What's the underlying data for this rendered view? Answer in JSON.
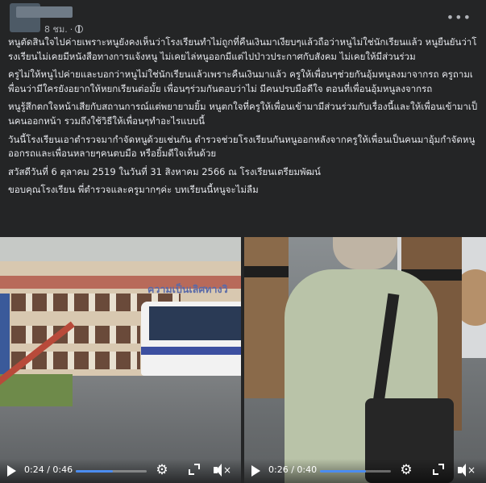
{
  "post": {
    "time": "8 ชม.",
    "separator": "·",
    "privacy_icon": "globe-icon",
    "more_icon": "more-horizontal-icon",
    "paragraphs": [
      "หนูตัดสินใจไปค่ายเพราะหนูยังคงเห็นว่าโรงเรียนทำไม่ถูกที่คืนเงินมาเงียบๆแล้วถือว่าหนูไม่ใช่นักเรียนแล้ว หนูยืนยันว่าโรงเรียนไม่เคยมีหนังสือทางการแจ้งหนู ไม่เคยไล่หนูออกมีแต่ไปป่าวประกาศกับสังคม ไม่เคยให้มีส่วนร่วม",
      "ครูไม่ให้หนูไปค่ายและบอกว่าหนูไม่ใช่นักเรียนแล้วเพราะคืนเงินมาแล้ว ครูให้เพื่อนๆช่วยกันอุ้มหนูลงมาจากรถ ครูถามเพื่อนว่ามีใครยังอยากให้หยกเรียนต่อมั้ย เพื่อนๆร่วมกันตอบว่าไม่ มีคนปรบมือดีใจ ตอนที่เพื่อนอุ้มหนูลงจากรถ",
      "หนูรู้สึกตกใจหน้าเสียกับสถานการณ์แต่พยายามยิ้ม หนูตกใจที่ครูให้เพื่อนเข้ามามีส่วนร่วมกับเรื่องนี้และให้เพื่อนเข้ามาเป็นคนออกหน้า รวมถึงใช้วิธีให้เพื่อนๆทำอะไรแบบนี้",
      "วันนี้โรงเรียนเอาตำรวจมากำจัดหนูด้วยเช่นกัน ตำรวจช่วยโรงเรียนกันหนูออกหลังจากครูให้เพื่อนเป็นคนมาอุ้มกำจัดหนูออกรถและเพื่อนหลายๆคนตบมือ หรือยิ้มดีใจเห็นด้วย",
      "สวัสดีวันที่ 6 ตุลาคม 2519 ในวันที่ 31 สิงหาคม 2566 ณ โรงเรียนเตรียมพัฒน์",
      "ขอบคุณโรงเรียน พี่ตำรวจและครูมากๆค่ะ บทเรียนนี้หนูจะไม่ลืม"
    ]
  },
  "videos": [
    {
      "signage": "ความเป็นเลิศทางวิ",
      "time_label": "0:24 / 0:46",
      "progress": 0.52,
      "play_icon": "play-icon",
      "settings_icon": "gear-icon",
      "fullscreen_icon": "expand-icon",
      "volume_icon": "volume-muted-icon"
    },
    {
      "time_label": "0:26 / 0:40",
      "progress": 0.65,
      "play_icon": "play-icon",
      "settings_icon": "gear-icon",
      "fullscreen_icon": "expand-icon",
      "volume_icon": "volume-muted-icon"
    }
  ],
  "colors": {
    "background": "#242526",
    "text": "#e4e6eb",
    "secondary_text": "#b0b3b8",
    "progress_accent": "#4b8cf0"
  }
}
